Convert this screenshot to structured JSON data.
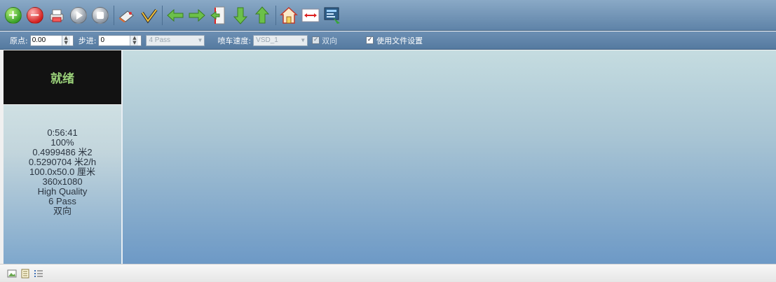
{
  "toolbar": {
    "buttons": [
      {
        "name": "add-icon",
        "color": "#3aa22a"
      },
      {
        "name": "remove-icon",
        "color": "#d42121"
      },
      {
        "name": "print-icon"
      },
      {
        "name": "play-icon"
      },
      {
        "name": "stop-icon"
      },
      {
        "name": "clean-icon"
      },
      {
        "name": "check-icon"
      },
      {
        "name": "arrow-left-icon"
      },
      {
        "name": "arrow-right-icon"
      },
      {
        "name": "origin-icon"
      },
      {
        "name": "arrow-down-icon"
      },
      {
        "name": "arrow-up-icon"
      },
      {
        "name": "home-icon"
      },
      {
        "name": "measure-icon"
      },
      {
        "name": "monitor-icon"
      }
    ]
  },
  "params": {
    "origin_label": "原点:",
    "origin_value": "0.00",
    "step_label": "步进:",
    "step_value": "0",
    "pass_value": "4 Pass",
    "speed_label": "喷车速度:",
    "speed_value": "VSD_1",
    "bidirectional_label": "双向",
    "bidirectional_checked": true,
    "use_file_settings_label": "使用文件设置",
    "use_file_settings_checked": true
  },
  "status": {
    "state": "就绪",
    "time": "0:56:41",
    "progress": "100%",
    "area": "0.4999486 米2",
    "rate": "0.5290704 米2/h",
    "size": "100.0x50.0 厘米",
    "resolution": "360x1080",
    "quality": "High Quality",
    "passes": "6 Pass",
    "direction": "双向"
  },
  "colors": {
    "status_text": "#9bd27a",
    "toolbar_bg": "#6f93b8"
  }
}
